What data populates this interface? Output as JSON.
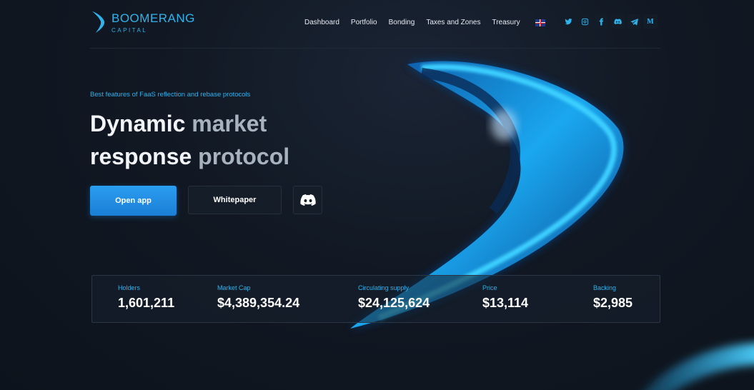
{
  "brand": {
    "name": "BOOMERANG",
    "sub": "CAPITAL"
  },
  "nav": [
    "Dashboard",
    "Portfolio",
    "Bonding",
    "Taxes and Zones",
    "Treasury"
  ],
  "language_flag": "uk-flag-icon",
  "socials": [
    "twitter-icon",
    "instagram-icon",
    "facebook-icon",
    "discord-icon",
    "telegram-icon",
    "medium-icon"
  ],
  "hero": {
    "tagline": "Best features of FaaS reflection and rebase protocols",
    "headline_1a": "Dynamic ",
    "headline_1b": "market",
    "headline_2a": "response ",
    "headline_2b": "protocol"
  },
  "buttons": {
    "open_app": "Open app",
    "whitepaper": "Whitepaper"
  },
  "stats": [
    {
      "label": "Holders",
      "value": "1,601,211"
    },
    {
      "label": "Market Cap",
      "value": "$4,389,354.24"
    },
    {
      "label": "Circulating supply",
      "value": "$24,125,624"
    },
    {
      "label": "Price",
      "value": "$13,114"
    },
    {
      "label": "Backing",
      "value": "$2,985"
    }
  ],
  "colors": {
    "accent": "#2fb3ec",
    "background": "#111823",
    "button_primary": "#1b7ed6"
  }
}
